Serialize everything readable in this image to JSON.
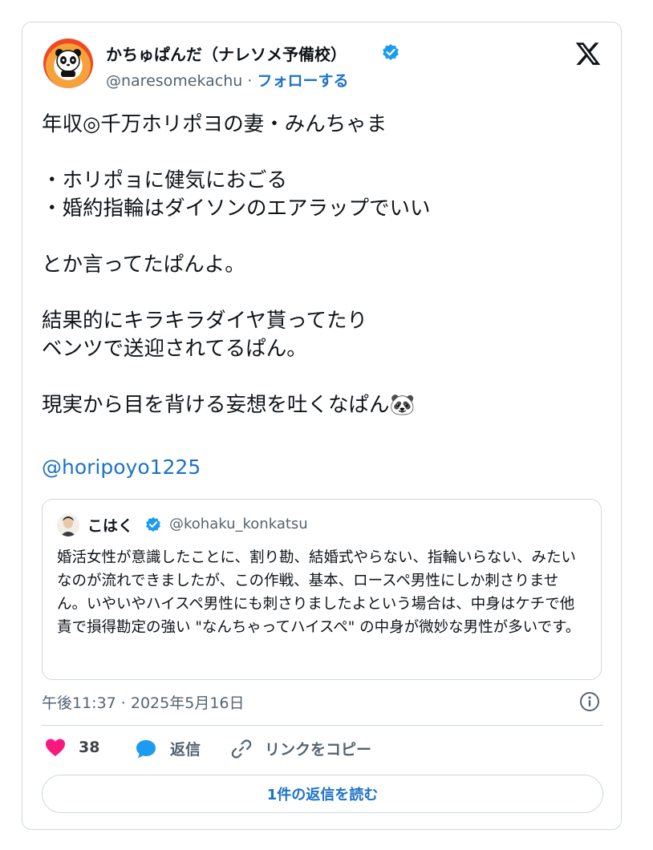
{
  "author": {
    "name": "かちゅぱんだ（ナレソメ予備校）",
    "handle": "@naresomekachu",
    "separator": "·",
    "follow_label": "フォローする"
  },
  "tweet": {
    "text": "年収◎千万ホリポヨの妻・みんちゃま\n\n・ホリポョに健気におごる\n・婚約指輪はダイソンのエアラップでいい\n\nとか言ってたぱんよ。\n\n結果的にキラキラダイヤ貰ってたり\nベンツで送迎されてるぱん。\n\n現実から目を背ける妄想を吐くなぱん🐼",
    "mention": "@horipoyo1225",
    "timestamp": "午後11:37 · 2025年5月16日"
  },
  "quoted": {
    "name": "こはく",
    "handle": "@kohaku_konkatsu",
    "text": "婚活女性が意識したことに、割り勘、結婚式やらない、指輪いらない、みたいなのが流れできましたが、この作戦、基本、ロースペ男性にしか刺さりません。いやいやハイスペ男性にも刺さりましたよという場合は、中身はケチで他責で損得勘定の強い \"なんちゃってハイスペ\" の中身が微妙な男性が多いです。"
  },
  "actions": {
    "likes": "38",
    "reply_label": "返信",
    "copy_link_label": "リンクをコピー"
  },
  "read_replies_label": "1件の返信を読む",
  "icons": {
    "verified": "verified-badge-icon",
    "x_logo": "x-logo-icon",
    "info": "info-icon",
    "like": "heart-icon",
    "reply": "speech-bubble-icon",
    "link": "link-icon"
  },
  "colors": {
    "accent": "#1d9bf0",
    "link": "#1d72c9",
    "like": "#f91880",
    "muted": "#536471",
    "border": "#cfd9de"
  }
}
